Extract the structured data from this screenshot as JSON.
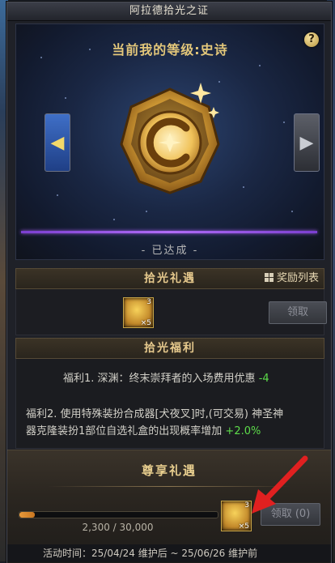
{
  "window": {
    "title": "阿拉德拾光之证"
  },
  "level": {
    "prefix": "当前我的等级:",
    "value": "史诗",
    "status": "- 已达成 -"
  },
  "help": {
    "label": "?"
  },
  "nav": {
    "prev_icon": "chevron-left-icon",
    "next_icon": "chevron-right-icon"
  },
  "gift": {
    "header": "拾光礼遇",
    "reward_list": "奖励列表",
    "item": {
      "count": "×5",
      "tier": "3"
    },
    "claim_label": "领取"
  },
  "welfare": {
    "header": "拾光福利",
    "lines": [
      {
        "text": "福利1. 深渊：终末崇拜者的入场费用优惠",
        "bonus": "-4"
      },
      {
        "text_a": "福利2. 使用特殊装扮合成器[犬夜叉]时,(可交易) 神圣神",
        "text_b": "器克隆装扮1部位自选礼盒的出现概率增加",
        "bonus": "+2.0%"
      }
    ]
  },
  "exclusive": {
    "title": "尊享礼遇",
    "progress": {
      "current": 2300,
      "max": 30000,
      "fraction": 0.0767,
      "label": "2,300 / 30,000"
    },
    "item": {
      "count": "×5",
      "tier": "3"
    },
    "claim_label": "领取 (0)"
  },
  "activity": {
    "text": "活动时间：25/04/24 维护后 ~ 25/06/26 维护前"
  },
  "colors": {
    "accent_gold": "#e3c77a",
    "purple_bar": "#b06cf5",
    "bonus_green": "#5ddc4a",
    "annotation_red": "#e02020"
  }
}
